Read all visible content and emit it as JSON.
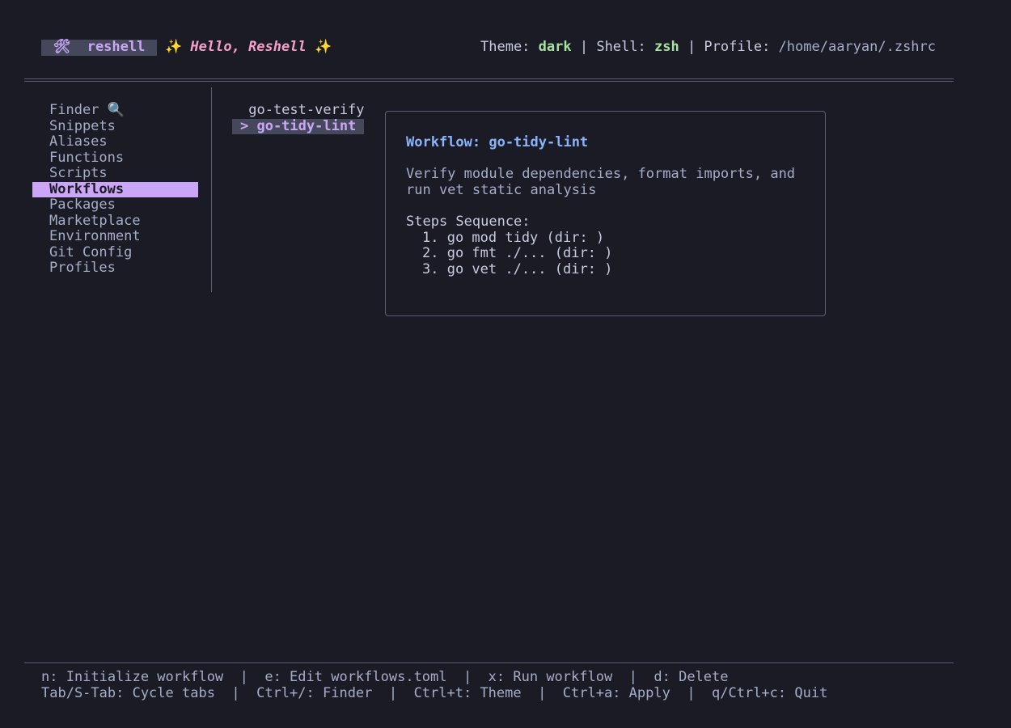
{
  "header": {
    "brand_icon": "🛠",
    "brand_label": "reshell",
    "greeting_spark": "✨",
    "greeting": "Hello, Reshell",
    "theme_label": "Theme: ",
    "theme_value": "dark",
    "sep": " | ",
    "shell_label": "Shell: ",
    "shell_value": "zsh",
    "profile_label": "Profile: ",
    "profile_value": "/home/aaryan/.zshrc"
  },
  "sidebar": {
    "items": [
      {
        "label": "Finder 🔍"
      },
      {
        "label": "Snippets"
      },
      {
        "label": "Aliases"
      },
      {
        "label": "Functions"
      },
      {
        "label": "Scripts"
      },
      {
        "label": "Workflows"
      },
      {
        "label": "Packages"
      },
      {
        "label": "Marketplace"
      },
      {
        "label": "Environment"
      },
      {
        "label": "Git Config"
      },
      {
        "label": "Profiles"
      }
    ],
    "active": "Workflows"
  },
  "workflows": {
    "items": [
      {
        "label": " go-test-verify"
      },
      {
        "label": "> go-tidy-lint"
      }
    ]
  },
  "detail": {
    "title": "Workflow: go-tidy-lint",
    "description_line1": "Verify module dependencies, format imports, and",
    "description_line2": "run vet static analysis",
    "steps_label": "Steps Sequence:",
    "steps": [
      "1. go mod tidy (dir: )",
      "2. go fmt ./... (dir: )",
      "3. go vet ./... (dir: )"
    ]
  },
  "footer": {
    "line1": "n: Initialize workflow  |  e: Edit workflows.toml  |  x: Run workflow  |  d: Delete",
    "line2": "Tab/S-Tab: Cycle tabs  |  Ctrl+/: Finder  |  Ctrl+t: Theme  |  Ctrl+a: Apply  |  q/Ctrl+c: Quit"
  },
  "colors": {
    "background": "#1b1b26",
    "accent": "#cba6f7",
    "pink": "#f5a0c8",
    "green": "#a6e3a1",
    "blue": "#89b4fa"
  }
}
